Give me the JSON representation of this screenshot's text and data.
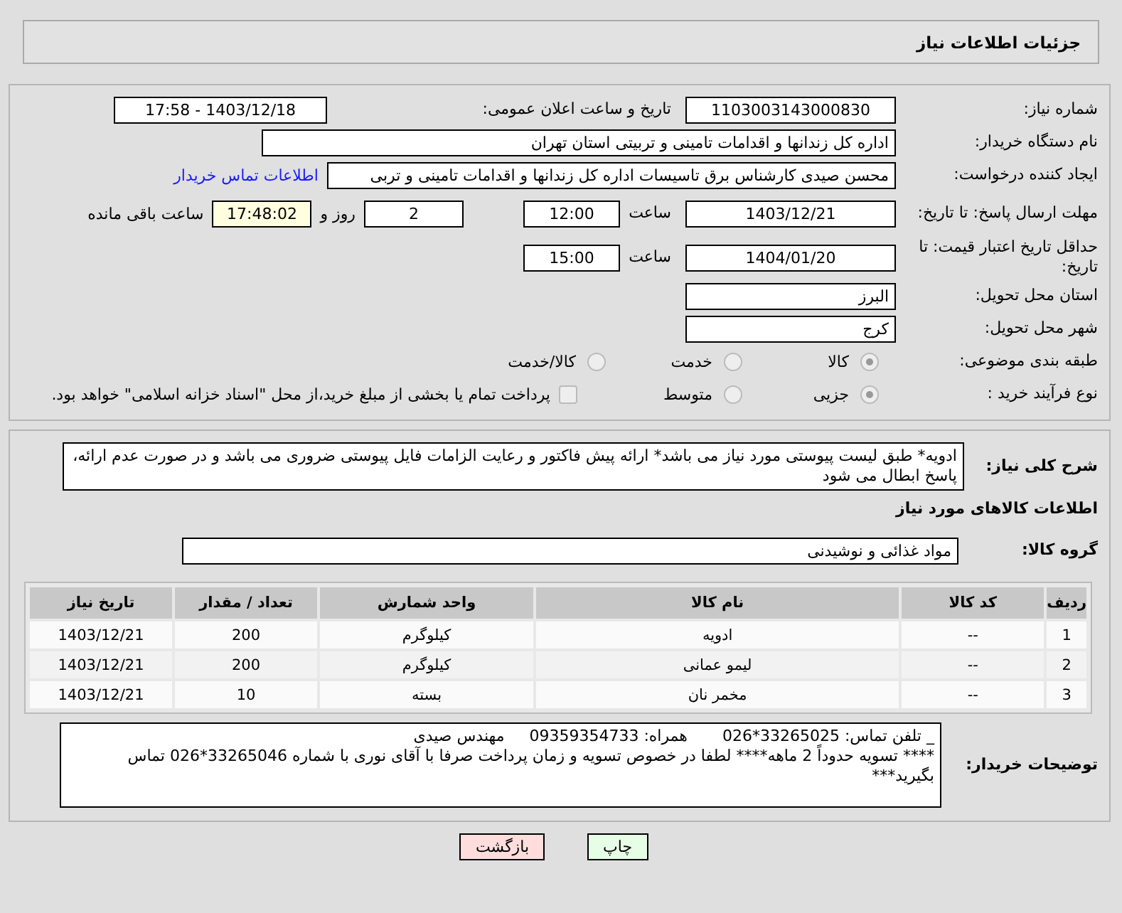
{
  "header": {
    "title": "جزئیات اطلاعات نیاز"
  },
  "need_number": {
    "label": "شماره نیاز:",
    "value": "1103003143000830"
  },
  "announce": {
    "label": "تاریخ و ساعت اعلان عمومی:",
    "value": "1403/12/18 - 17:58"
  },
  "buyer_org": {
    "label": "نام دستگاه خریدار:",
    "value": "اداره کل زندانها و اقدامات تامینی و تربیتی استان تهران"
  },
  "requester": {
    "label": "ایجاد کننده درخواست:",
    "value": "محسن صیدی کارشناس برق تاسیسات  اداره کل زندانها و اقدامات تامینی و تربی",
    "link": "اطلاعات تماس خریدار"
  },
  "deadline": {
    "label": "مهلت ارسال پاسخ: تا تاریخ:",
    "date": "1403/12/21",
    "time_label": "ساعت",
    "time": "12:00",
    "days": "2",
    "days_label": "روز و",
    "remaining": "17:48:02",
    "remaining_label": "ساعت باقی مانده"
  },
  "validity": {
    "label": "حداقل تاریخ اعتبار قیمت: تا تاریخ:",
    "date": "1404/01/20",
    "time_label": "ساعت",
    "time": "15:00"
  },
  "province": {
    "label": "استان محل تحویل:",
    "value": "البرز"
  },
  "city": {
    "label": "شهر محل تحویل:",
    "value": "کرج"
  },
  "category": {
    "label": "طبقه بندی موضوعی:",
    "options": [
      {
        "label": "کالا",
        "selected": true
      },
      {
        "label": "خدمت",
        "selected": false
      },
      {
        "label": "کالا/خدمت",
        "selected": false
      }
    ]
  },
  "purchase_type": {
    "label": "نوع فرآیند خرید :",
    "options": [
      {
        "label": "جزیی",
        "selected": true
      },
      {
        "label": "متوسط",
        "selected": false
      }
    ],
    "treasury": {
      "label": "پرداخت تمام یا بخشی از مبلغ خرید،از محل \"اسناد خزانه اسلامی\" خواهد بود.",
      "checked": false
    }
  },
  "description": {
    "label": "شرح کلی نیاز:",
    "value": "ادویه* طبق لیست پیوستی مورد نیاز می باشد* ارائه پیش فاکتور و رعایت الزامات فایل پیوستی ضروری می باشد و در صورت عدم ارائه، پاسخ ابطال می شود"
  },
  "goods_heading": "اطلاعات کالاهای مورد نیاز",
  "goods_group": {
    "label": "گروه کالا:",
    "value": "مواد غذائی و نوشیدنی"
  },
  "table": {
    "columns": [
      "ردیف",
      "کد کالا",
      "نام کالا",
      "واحد شمارش",
      "تعداد / مقدار",
      "تاریخ نیاز"
    ],
    "rows": [
      [
        "1",
        "--",
        "ادویه",
        "کیلوگرم",
        "200",
        "1403/12/21"
      ],
      [
        "2",
        "--",
        "لیمو عمانی",
        "کیلوگرم",
        "200",
        "1403/12/21"
      ],
      [
        "3",
        "--",
        "مخمر نان",
        "بسته",
        "10",
        "1403/12/21"
      ]
    ]
  },
  "buyer_notes": {
    "label": "توضیحات خریدار:",
    "value": "_ تلفن تماس: 33265025*026       همراه: 09359354733     مهندس صیدی\n**** تسویه حدوداً 2 ماهه**** لطفا در خصوص تسویه و زمان پرداخت صرفا با آقای نوری با شماره 33265046*026 تماس بگیرید***"
  },
  "buttons": [
    {
      "label": "چاپ",
      "kind": "print"
    },
    {
      "label": "بازگشت",
      "kind": "back"
    }
  ]
}
